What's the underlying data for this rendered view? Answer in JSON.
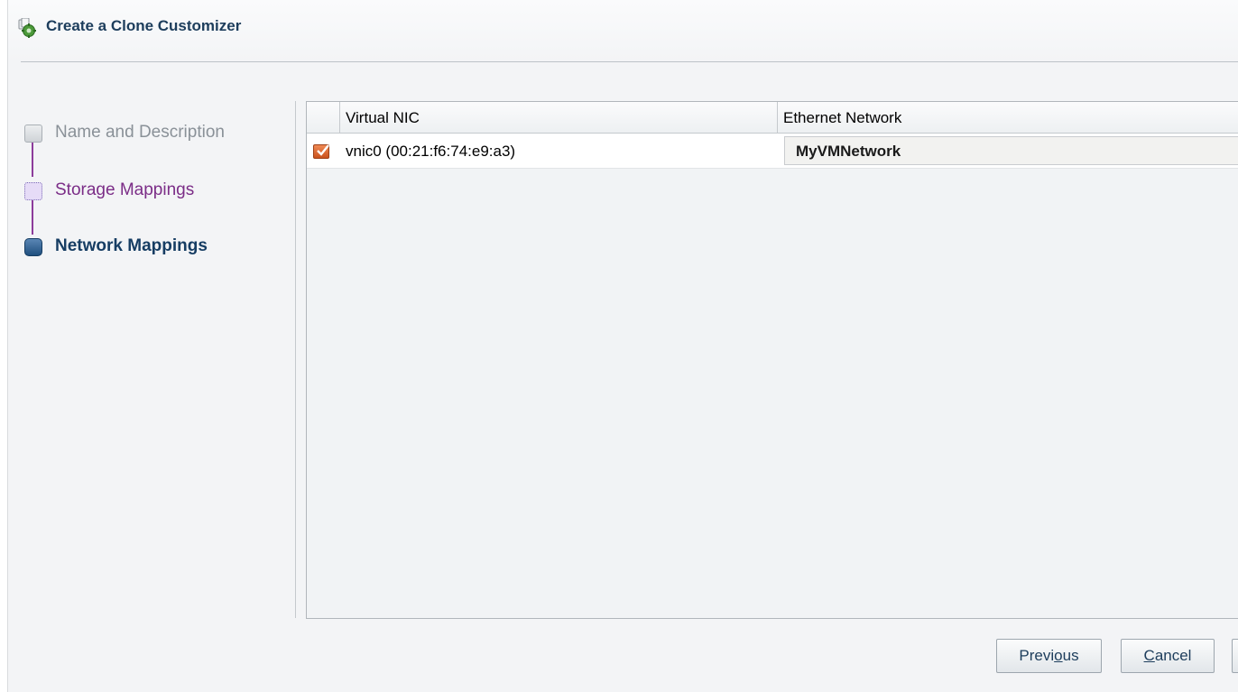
{
  "window": {
    "title": "Create a Clone Customizer",
    "icon": "gear-clone-icon"
  },
  "train": {
    "steps": [
      {
        "label": "Name and Description",
        "state": "visited"
      },
      {
        "label": "Storage Mappings",
        "state": "unvisited"
      },
      {
        "label": "Network Mappings",
        "state": "current"
      }
    ]
  },
  "table": {
    "columns": [
      "Virtual NIC",
      "Ethernet Network"
    ],
    "rows": [
      {
        "checked": true,
        "virtual_nic": "vnic0 (00:21:f6:74:e9:a3)",
        "ethernet_network": "MyVMNetwork"
      }
    ]
  },
  "buttons": {
    "previous": {
      "prefix": "Previ",
      "mnemonic": "o",
      "suffix": "us"
    },
    "cancel": {
      "prefix": "",
      "mnemonic": "C",
      "suffix": "ancel"
    }
  },
  "colors": {
    "title": "#1d3d5c",
    "current_step": "#163d63",
    "unvisited_step": "#7b2d87",
    "checkbox": "#e06a32"
  }
}
